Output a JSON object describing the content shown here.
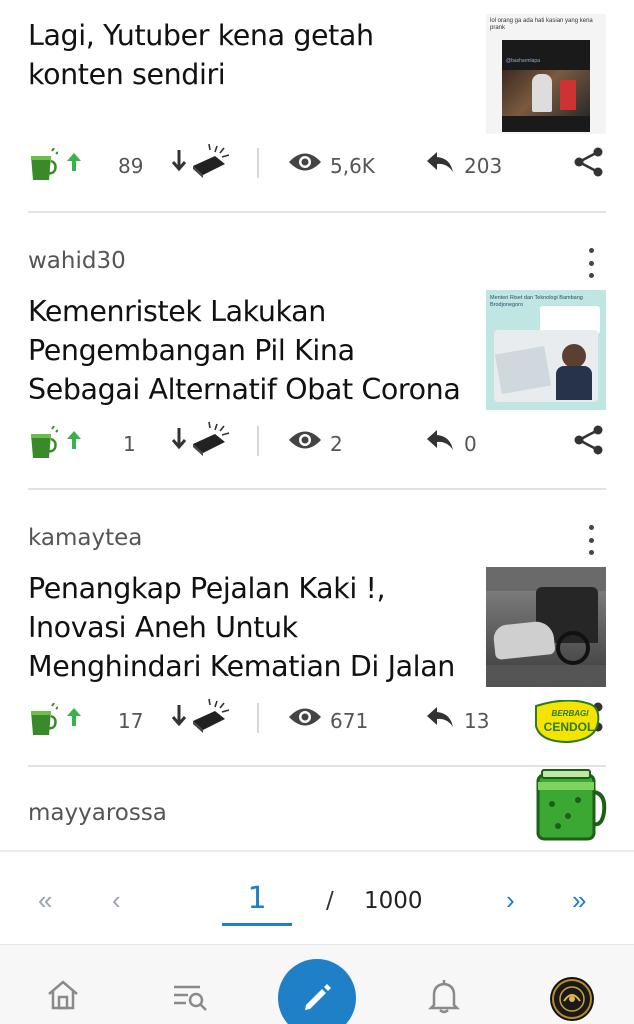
{
  "posts": [
    {
      "author": "",
      "title": "Lagi, Yutuber kena getah konten sendiri",
      "cendol": "89",
      "views": "5,6K",
      "replies": "203",
      "thumb_text": "lol orang ga ada hati kasian yang kena prank",
      "thumb_handle": "@basharmlapa"
    },
    {
      "author": "wahid30",
      "title": "Kemenristek Lakukan Pengembangan Pil Kina Sebagai Alternatif Obat Corona",
      "cendol": "1",
      "views": "2",
      "replies": "0",
      "thumb_text": "Menteri Riset dan Teknologi Bambang Brodjonegoro",
      "thumb_handle": ""
    },
    {
      "author": "kamaytea",
      "title": "Penangkap Pejalan Kaki !, Inovasi Aneh Untuk Menghindari Kematian Di Jalan",
      "cendol": "17",
      "views": "671",
      "replies": "13",
      "thumb_text": "",
      "thumb_handle": ""
    },
    {
      "author": "mayyarossa",
      "title": "",
      "cendol": "",
      "views": "",
      "replies": "",
      "thumb_text": "",
      "thumb_handle": ""
    }
  ],
  "badge": {
    "line1": "BERBAGI",
    "line2": "CENDOL"
  },
  "pagination": {
    "first": "«",
    "prev": "‹",
    "current": "1",
    "slash": "/",
    "total": "1000",
    "next": "›",
    "last": "»"
  },
  "nav": {
    "items": [
      "home-icon",
      "search-list-icon",
      "pencil-icon",
      "bell-icon",
      "avatar"
    ]
  },
  "colors": {
    "accent": "#1f7fc7",
    "green": "#37b34a",
    "cendol_green": "#3a8a2a",
    "badge_yellow": "#f5e400"
  }
}
